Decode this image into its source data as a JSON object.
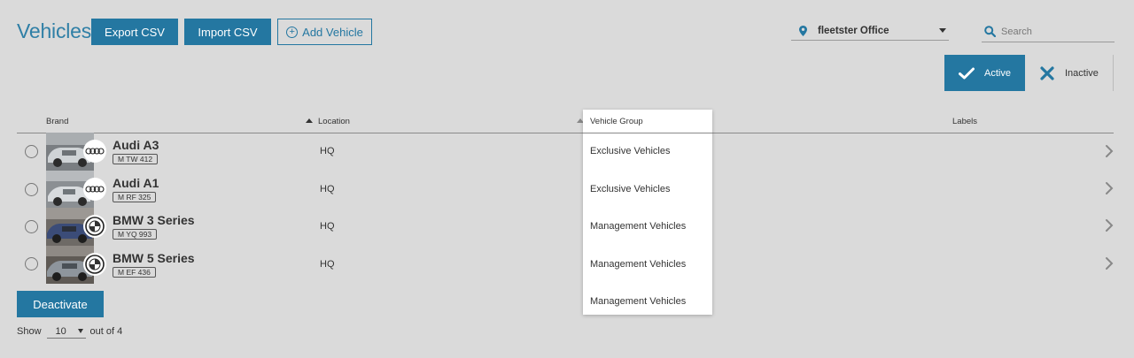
{
  "header": {
    "title": "Vehicles",
    "export_label": "Export CSV",
    "import_label": "Import CSV",
    "add_label": "Add Vehicle",
    "location": "fleetster Office",
    "search_placeholder": "Search"
  },
  "status_toggle": {
    "active_label": "Active",
    "inactive_label": "Inactive"
  },
  "table": {
    "columns": {
      "brand": "Brand",
      "location": "Location",
      "vehicle_group": "Vehicle Group",
      "labels": "Labels"
    },
    "rows": [
      {
        "model": "Audi A3",
        "plate": "M TW 412",
        "location": "HQ",
        "group": "Exclusive Vehicles",
        "brand": "audi"
      },
      {
        "model": "Audi A1",
        "plate": "M RF 325",
        "location": "HQ",
        "group": "Exclusive Vehicles",
        "brand": "audi"
      },
      {
        "model": "BMW 3 Series",
        "plate": "M YQ 993",
        "location": "HQ",
        "group": "Management Vehicles",
        "brand": "bmw"
      },
      {
        "model": "BMW 5 Series",
        "plate": "M EF 436",
        "location": "HQ",
        "group": "Management Vehicles",
        "brand": "bmw"
      }
    ]
  },
  "group_dropdown": {
    "title": "Vehicle Group",
    "items": [
      "Exclusive Vehicles",
      "Exclusive Vehicles",
      "Management Vehicles",
      "Management Vehicles",
      "Management Vehicles"
    ]
  },
  "footer": {
    "deactivate_label": "Deactivate",
    "show_label": "Show",
    "page_size": "10",
    "count_text": "out of 4"
  },
  "colors": {
    "accent": "#2477a1",
    "background": "#dadada"
  }
}
